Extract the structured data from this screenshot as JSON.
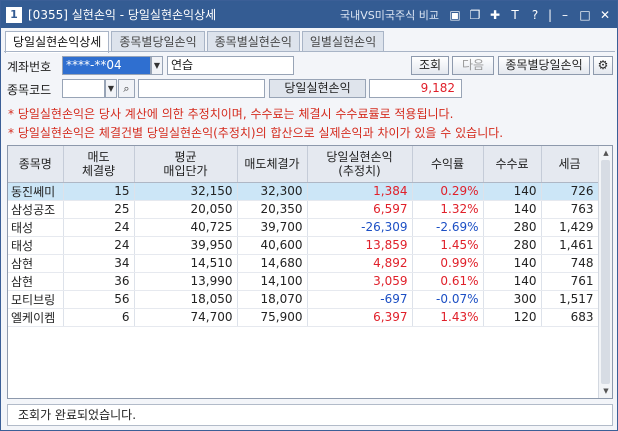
{
  "title": {
    "window_number": "1",
    "screen_code": "[0355]",
    "text": "실현손익 - 당일실현손익상세",
    "link": "국내VS미국주식 비교"
  },
  "tabs": [
    {
      "label": "당일실현손익상세"
    },
    {
      "label": "종목별당일손익"
    },
    {
      "label": "종목별실현손익"
    },
    {
      "label": "일별실현손익"
    }
  ],
  "account": {
    "label": "계좌번호",
    "number": "****-**04",
    "name": "연습"
  },
  "stock": {
    "label": "종목코드",
    "code_value": "",
    "name_value": ""
  },
  "buttons": {
    "query": "조회",
    "next": "다음",
    "by_stock": "종목별당일손익"
  },
  "profit": {
    "label": "당일실현손익",
    "value": "9,182"
  },
  "notes": [
    "* 당일실현손익은 당사 계산에 의한 추정치이며, 수수료는 체결시 수수료률로 적용됩니다.",
    "* 당일실현손익은 체결건별 당일실현손익(추정치)의 합산으로 실제손익과 차이가 있을 수 있습니다."
  ],
  "table": {
    "headers": [
      "종목명",
      "매도\n체결량",
      "평균\n매입단가",
      "매도체결가",
      "당일실현손익\n(추정치)",
      "수익률",
      "수수료",
      "세금"
    ],
    "rows": [
      {
        "name": "동진쎄미",
        "qty": "15",
        "avg": "32,150",
        "sell": "32,300",
        "pnl": "1,384",
        "rate": "0.29%",
        "fee": "140",
        "tax": "726"
      },
      {
        "name": "삼성공조",
        "qty": "25",
        "avg": "20,050",
        "sell": "20,350",
        "pnl": "6,597",
        "rate": "1.32%",
        "fee": "140",
        "tax": "763"
      },
      {
        "name": "태성",
        "qty": "24",
        "avg": "40,725",
        "sell": "39,700",
        "pnl": "-26,309",
        "rate": "-2.69%",
        "fee": "280",
        "tax": "1,429"
      },
      {
        "name": "태성",
        "qty": "24",
        "avg": "39,950",
        "sell": "40,600",
        "pnl": "13,859",
        "rate": "1.45%",
        "fee": "280",
        "tax": "1,461"
      },
      {
        "name": "삼현",
        "qty": "34",
        "avg": "14,510",
        "sell": "14,680",
        "pnl": "4,892",
        "rate": "0.99%",
        "fee": "140",
        "tax": "748"
      },
      {
        "name": "삼현",
        "qty": "36",
        "avg": "13,990",
        "sell": "14,100",
        "pnl": "3,059",
        "rate": "0.61%",
        "fee": "140",
        "tax": "761"
      },
      {
        "name": "모티브링",
        "qty": "56",
        "avg": "18,050",
        "sell": "18,070",
        "pnl": "-697",
        "rate": "-0.07%",
        "fee": "300",
        "tax": "1,517"
      },
      {
        "name": "엘케이켐",
        "qty": "6",
        "avg": "74,700",
        "sell": "75,900",
        "pnl": "6,397",
        "rate": "1.43%",
        "fee": "120",
        "tax": "683"
      }
    ]
  },
  "status": "조회가 완료되었습니다.",
  "colors": {
    "profit": "#e0202a",
    "loss": "#1c4fc4",
    "selected_row": "#cce6f7",
    "titlebar": "#345c93"
  }
}
